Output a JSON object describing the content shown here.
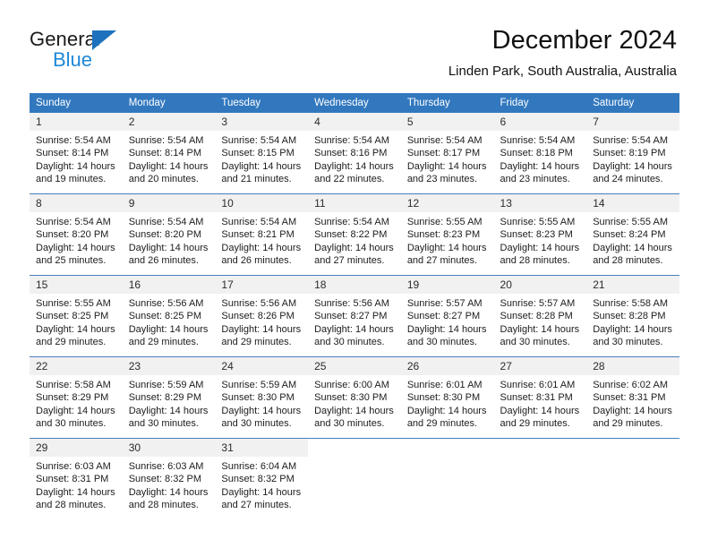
{
  "brand": {
    "name_part1": "General",
    "name_part2": "Blue",
    "logo_icon": "triangle-icon"
  },
  "header": {
    "title": "December 2024",
    "subtitle": "Linden Park, South Australia, Australia"
  },
  "colors": {
    "header_bar": "#3278be",
    "brand_blue": "#1e88d8",
    "daynum_band": "#f1f1f1",
    "row_divider": "#4a7ebb"
  },
  "weekdays": [
    "Sunday",
    "Monday",
    "Tuesday",
    "Wednesday",
    "Thursday",
    "Friday",
    "Saturday"
  ],
  "weeks": [
    [
      {
        "day": "1",
        "sunrise": "Sunrise: 5:54 AM",
        "sunset": "Sunset: 8:14 PM",
        "daylight": "Daylight: 14 hours and 19 minutes."
      },
      {
        "day": "2",
        "sunrise": "Sunrise: 5:54 AM",
        "sunset": "Sunset: 8:14 PM",
        "daylight": "Daylight: 14 hours and 20 minutes."
      },
      {
        "day": "3",
        "sunrise": "Sunrise: 5:54 AM",
        "sunset": "Sunset: 8:15 PM",
        "daylight": "Daylight: 14 hours and 21 minutes."
      },
      {
        "day": "4",
        "sunrise": "Sunrise: 5:54 AM",
        "sunset": "Sunset: 8:16 PM",
        "daylight": "Daylight: 14 hours and 22 minutes."
      },
      {
        "day": "5",
        "sunrise": "Sunrise: 5:54 AM",
        "sunset": "Sunset: 8:17 PM",
        "daylight": "Daylight: 14 hours and 23 minutes."
      },
      {
        "day": "6",
        "sunrise": "Sunrise: 5:54 AM",
        "sunset": "Sunset: 8:18 PM",
        "daylight": "Daylight: 14 hours and 23 minutes."
      },
      {
        "day": "7",
        "sunrise": "Sunrise: 5:54 AM",
        "sunset": "Sunset: 8:19 PM",
        "daylight": "Daylight: 14 hours and 24 minutes."
      }
    ],
    [
      {
        "day": "8",
        "sunrise": "Sunrise: 5:54 AM",
        "sunset": "Sunset: 8:20 PM",
        "daylight": "Daylight: 14 hours and 25 minutes."
      },
      {
        "day": "9",
        "sunrise": "Sunrise: 5:54 AM",
        "sunset": "Sunset: 8:20 PM",
        "daylight": "Daylight: 14 hours and 26 minutes."
      },
      {
        "day": "10",
        "sunrise": "Sunrise: 5:54 AM",
        "sunset": "Sunset: 8:21 PM",
        "daylight": "Daylight: 14 hours and 26 minutes."
      },
      {
        "day": "11",
        "sunrise": "Sunrise: 5:54 AM",
        "sunset": "Sunset: 8:22 PM",
        "daylight": "Daylight: 14 hours and 27 minutes."
      },
      {
        "day": "12",
        "sunrise": "Sunrise: 5:55 AM",
        "sunset": "Sunset: 8:23 PM",
        "daylight": "Daylight: 14 hours and 27 minutes."
      },
      {
        "day": "13",
        "sunrise": "Sunrise: 5:55 AM",
        "sunset": "Sunset: 8:23 PM",
        "daylight": "Daylight: 14 hours and 28 minutes."
      },
      {
        "day": "14",
        "sunrise": "Sunrise: 5:55 AM",
        "sunset": "Sunset: 8:24 PM",
        "daylight": "Daylight: 14 hours and 28 minutes."
      }
    ],
    [
      {
        "day": "15",
        "sunrise": "Sunrise: 5:55 AM",
        "sunset": "Sunset: 8:25 PM",
        "daylight": "Daylight: 14 hours and 29 minutes."
      },
      {
        "day": "16",
        "sunrise": "Sunrise: 5:56 AM",
        "sunset": "Sunset: 8:25 PM",
        "daylight": "Daylight: 14 hours and 29 minutes."
      },
      {
        "day": "17",
        "sunrise": "Sunrise: 5:56 AM",
        "sunset": "Sunset: 8:26 PM",
        "daylight": "Daylight: 14 hours and 29 minutes."
      },
      {
        "day": "18",
        "sunrise": "Sunrise: 5:56 AM",
        "sunset": "Sunset: 8:27 PM",
        "daylight": "Daylight: 14 hours and 30 minutes."
      },
      {
        "day": "19",
        "sunrise": "Sunrise: 5:57 AM",
        "sunset": "Sunset: 8:27 PM",
        "daylight": "Daylight: 14 hours and 30 minutes."
      },
      {
        "day": "20",
        "sunrise": "Sunrise: 5:57 AM",
        "sunset": "Sunset: 8:28 PM",
        "daylight": "Daylight: 14 hours and 30 minutes."
      },
      {
        "day": "21",
        "sunrise": "Sunrise: 5:58 AM",
        "sunset": "Sunset: 8:28 PM",
        "daylight": "Daylight: 14 hours and 30 minutes."
      }
    ],
    [
      {
        "day": "22",
        "sunrise": "Sunrise: 5:58 AM",
        "sunset": "Sunset: 8:29 PM",
        "daylight": "Daylight: 14 hours and 30 minutes."
      },
      {
        "day": "23",
        "sunrise": "Sunrise: 5:59 AM",
        "sunset": "Sunset: 8:29 PM",
        "daylight": "Daylight: 14 hours and 30 minutes."
      },
      {
        "day": "24",
        "sunrise": "Sunrise: 5:59 AM",
        "sunset": "Sunset: 8:30 PM",
        "daylight": "Daylight: 14 hours and 30 minutes."
      },
      {
        "day": "25",
        "sunrise": "Sunrise: 6:00 AM",
        "sunset": "Sunset: 8:30 PM",
        "daylight": "Daylight: 14 hours and 30 minutes."
      },
      {
        "day": "26",
        "sunrise": "Sunrise: 6:01 AM",
        "sunset": "Sunset: 8:30 PM",
        "daylight": "Daylight: 14 hours and 29 minutes."
      },
      {
        "day": "27",
        "sunrise": "Sunrise: 6:01 AM",
        "sunset": "Sunset: 8:31 PM",
        "daylight": "Daylight: 14 hours and 29 minutes."
      },
      {
        "day": "28",
        "sunrise": "Sunrise: 6:02 AM",
        "sunset": "Sunset: 8:31 PM",
        "daylight": "Daylight: 14 hours and 29 minutes."
      }
    ],
    [
      {
        "day": "29",
        "sunrise": "Sunrise: 6:03 AM",
        "sunset": "Sunset: 8:31 PM",
        "daylight": "Daylight: 14 hours and 28 minutes."
      },
      {
        "day": "30",
        "sunrise": "Sunrise: 6:03 AM",
        "sunset": "Sunset: 8:32 PM",
        "daylight": "Daylight: 14 hours and 28 minutes."
      },
      {
        "day": "31",
        "sunrise": "Sunrise: 6:04 AM",
        "sunset": "Sunset: 8:32 PM",
        "daylight": "Daylight: 14 hours and 27 minutes."
      },
      {
        "day": "",
        "sunrise": "",
        "sunset": "",
        "daylight": ""
      },
      {
        "day": "",
        "sunrise": "",
        "sunset": "",
        "daylight": ""
      },
      {
        "day": "",
        "sunrise": "",
        "sunset": "",
        "daylight": ""
      },
      {
        "day": "",
        "sunrise": "",
        "sunset": "",
        "daylight": ""
      }
    ]
  ]
}
